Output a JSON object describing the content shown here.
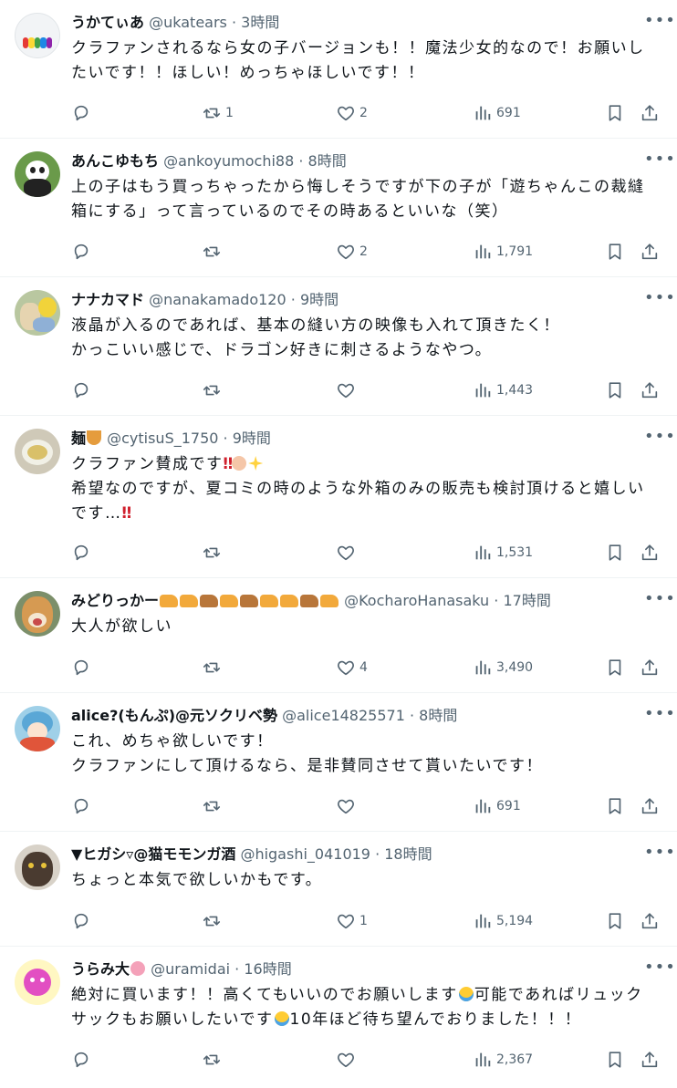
{
  "posts": [
    {
      "name": "うかてぃあ",
      "handle": "@ukatears",
      "time": "3時間",
      "text": "クラファンされるなら女の子バージョンも！！魔法少女的なので！お願いし\nたいです！！ほしい！めっちゃほしいです！！",
      "retweets": "1",
      "likes": "2",
      "views": "691"
    },
    {
      "name": "あんこゆもち",
      "handle": "@ankoyumochi88",
      "time": "8時間",
      "text": "上の子はもう買っちゃったから悔しそうですが下の子が「遊ちゃんこの裁縫\n箱にする」って言っているのでその時あるといいな（笑）",
      "retweets": "",
      "likes": "2",
      "views": "1,791"
    },
    {
      "name": "ナナカマド",
      "handle": "@nanakamado120",
      "time": "9時間",
      "text": "液晶が入るのであれば、基本の縫い方の映像も入れて頂きたく！\nかっこいい感じで、ドラゴン好きに刺さるようなやつ。",
      "retweets": "",
      "likes": "",
      "views": "1,443"
    },
    {
      "name": "麺",
      "handle": "@cytisuS_1750",
      "time": "9時間",
      "text_line1": "クラファン賛成です",
      "text_rest": "希望なのですが、夏コミの時のような外箱のみの販売も検討頂けると嬉しい\nです…",
      "retweets": "",
      "likes": "",
      "views": "1,531"
    },
    {
      "name": "みどりっかー",
      "handle": "@KocharoHanasaku",
      "time": "17時間",
      "text": "大人が欲しい",
      "retweets": "",
      "likes": "4",
      "views": "3,490"
    },
    {
      "name": "alice?(もんぷ)@元ソクリベ勢",
      "handle": "@alice14825571",
      "time": "8時間",
      "text": "これ、めちゃ欲しいです！\nクラファンにして頂けるなら、是非賛同させて貰いたいです！",
      "retweets": "",
      "likes": "",
      "views": "691"
    },
    {
      "name": "▼ヒガシ▿@猫モモンガ酒",
      "handle": "@higashi_041019",
      "time": "18時間",
      "text": "ちょっと本気で欲しいかもです。",
      "retweets": "",
      "likes": "1",
      "views": "5,194"
    },
    {
      "name": "うらみ大",
      "handle": "@uramidai",
      "time": "16時間",
      "text_a": "絶対に買います！！高くてもいいのでお願いします",
      "text_b": "可能であればリュック\nサックもお願いしたいです",
      "text_c": "10年ほど待ち望んでおりました！！！",
      "retweets": "",
      "likes": "",
      "views": "2,367"
    }
  ],
  "icons": {
    "reply": "reply-icon",
    "retweet": "retweet-icon",
    "like": "heart-icon",
    "views": "views-chart-icon",
    "bookmark": "bookmark-icon",
    "share": "share-icon",
    "more": "more-dots-icon"
  },
  "colors": {
    "text": "#0f1419",
    "secondary": "#536471",
    "divider": "#eff3f4"
  }
}
